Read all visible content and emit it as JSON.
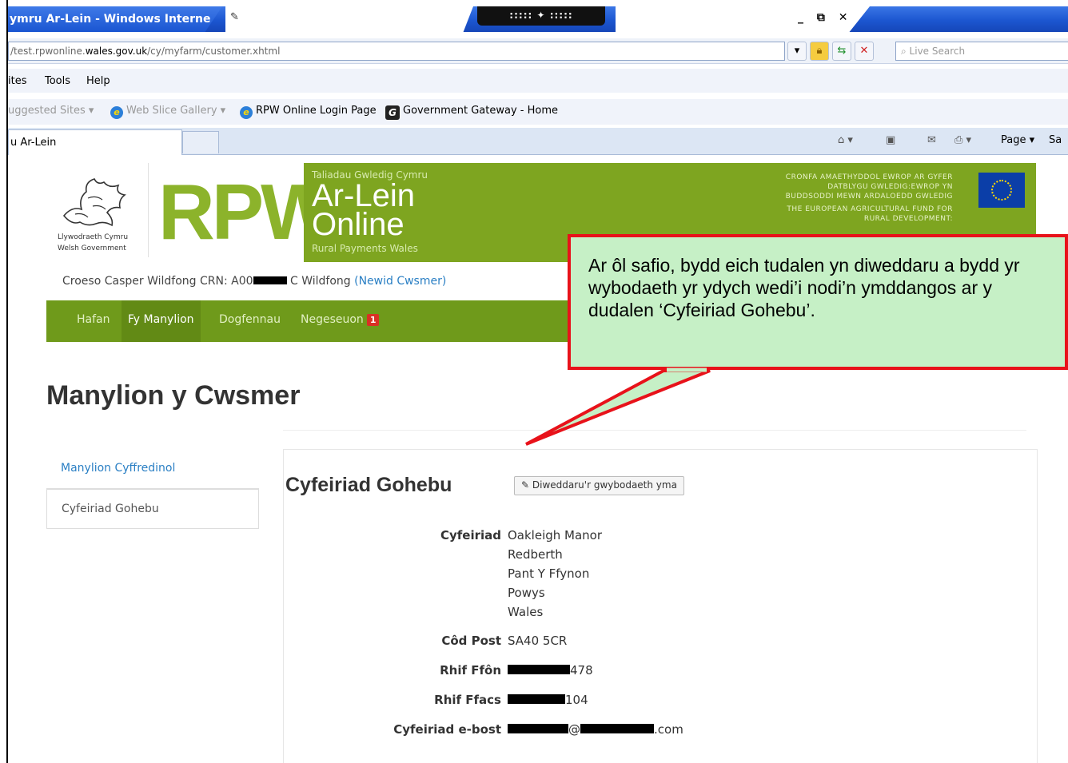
{
  "browser": {
    "title": "ymru Ar-Lein - Windows Interne",
    "fullscreen_bar": "::::: ✦ :::::",
    "window_controls": "_ ⧉ ✕",
    "url_prefix": "/test.rpwonline.",
    "url_host": "wales.gov.uk",
    "url_path": "/cy/myfarm/customer.xhtml",
    "search_placeholder": "Live Search",
    "menu": [
      "ites",
      "Tools",
      "Help"
    ],
    "favorites": {
      "suggested": "uggested Sites ▾",
      "web_slice": "Web Slice Gallery ▾",
      "rpw_login": "RPW Online Login Page",
      "gateway": "Government Gateway - Home"
    },
    "tab_title": "u Ar-Lein",
    "commands": {
      "page": "Page ▾",
      "safety": "Sa"
    }
  },
  "header": {
    "wg_cy": "Llywodraeth Cymru",
    "wg_en": "Welsh Government",
    "rpw": "RPW",
    "banner_cy": "Taliadau Gwledig Cymru",
    "banner_arlein": "Ar-Lein",
    "banner_online": "Online",
    "banner_en": "Rural Payments Wales",
    "eu_text_1": "CRONFA AMAETHYDDOL EWROP AR GYFER",
    "eu_text_2": "DATBLYGU GWLEDIG:EWROP YN",
    "eu_text_3": "BUDDSODDI MEWN ARDALOEDD GWLEDIG",
    "eu_text_4": "THE EUROPEAN AGRICULTURAL FUND FOR",
    "eu_text_5": "RURAL DEVELOPMENT:"
  },
  "welcome": {
    "prefix": "Croeso Casper Wildfong CRN: A00",
    "suffix": " C Wildfong ",
    "change_link": "(Newid Cwsmer)"
  },
  "nav": {
    "items": [
      "Hafan",
      "Fy Manylion",
      "Dogfennau",
      "Negeseuon"
    ],
    "badge": "1"
  },
  "page": {
    "title": "Manylion y Cwsmer",
    "side_nav": [
      "Manylion Cyffredinol",
      "Cyfeiriad Gohebu"
    ],
    "section_title": "Cyfeiriad Gohebu",
    "edit_button": "Diweddaru'r gwybodaeth yma",
    "fields": {
      "address_label": "Cyfeiriad",
      "address_lines": [
        "Oakleigh Manor",
        "Redberth",
        "Pant Y Ffynon",
        "Powys",
        "Wales"
      ],
      "postcode_label": "Côd Post",
      "postcode": "SA40 5CR",
      "phone_label": "Rhif Ffôn",
      "phone_suffix": "478",
      "fax_label": "Rhif Ffacs",
      "fax_suffix": "104",
      "email_label": "Cyfeiriad e-bost",
      "email_at": "@",
      "email_suffix": ".com"
    }
  },
  "callout": {
    "text": "Ar ôl safio, bydd eich tudalen yn diweddaru a bydd yr wybodaeth yr ydych wedi’i nodi’n ymddangos ar y dudalen ‘Cyfeiriad Gohebu’."
  },
  "colors": {
    "callout_fill": "#c6f0c6",
    "callout_border": "#e8121a",
    "brand_green": "#7ea520",
    "link_blue": "#2a7fc4"
  },
  "icons": [
    "pin-icon",
    "lock-icon",
    "refresh-icon",
    "stop-icon",
    "search-icon",
    "ie-icon",
    "gateway-icon",
    "home-icon",
    "feeds-icon",
    "mail-icon",
    "print-icon",
    "pencil-icon",
    "eu-flag-icon",
    "dragon-logo"
  ]
}
